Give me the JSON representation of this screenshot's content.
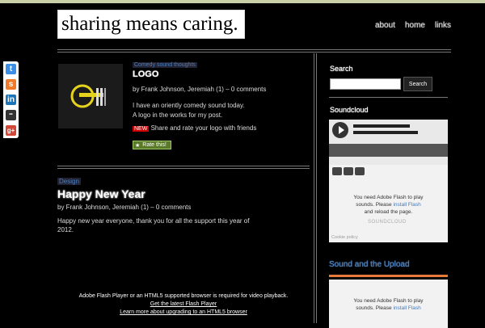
{
  "header": {
    "site_title": "sharing means caring.",
    "nav": [
      "about",
      "home",
      "links"
    ]
  },
  "share": {
    "items": [
      {
        "name": "twitter",
        "glyph": "t",
        "color": "#3a8ee6"
      },
      {
        "name": "soundcloud",
        "glyph": "s",
        "color": "#f07a2a"
      },
      {
        "name": "linkedin",
        "glyph": "in",
        "color": "#1b75b8"
      },
      {
        "name": "delicious",
        "glyph": "••",
        "color": "#333333"
      },
      {
        "name": "google-plus",
        "glyph": "g+",
        "color": "#d14836"
      }
    ]
  },
  "post1": {
    "category": "Comedy sound thoughts",
    "title": "LOGO",
    "meta": "by Frank Johnson, Jeremiah (1) – 0 comments",
    "body1": "I have an oriently comedy sound today.",
    "body2": "A logo in the works for my post.",
    "badge": "NEW",
    "body3": "Share and rate your logo with friends",
    "rate_label": "Rate this!"
  },
  "post2": {
    "tag": "Design",
    "title": "Happy New Year",
    "meta": "by Frank Johnson, Jeremiah (1) – 0 comments",
    "body1": "Happy new year everyone, thank you for all the support this year of",
    "body2": "2012."
  },
  "flash_notice": {
    "line1": "Adobe Flash Player or an HTML5 supported browser is required for video playback.",
    "link1": "Get the latest Flash Player",
    "link2": "Learn more about upgrading to an HTML5 browser"
  },
  "sidebar": {
    "search_heading": "Search",
    "search_button": "Search",
    "sound_heading": "Soundcloud",
    "flash_line1": "You need Adobe Flash to play",
    "flash_line2a": "sounds. Please",
    "flash_link": "install Flash",
    "flash_line3": "and reload the page.",
    "sc_logo": "SOUNDCLOUD",
    "cookie_text": "Cookie policy",
    "heading2": "Sound and the Upload",
    "flash2_line1": "You need Adobe Flash to play",
    "flash2_line2a": "sounds. Please",
    "flash2_link": "install Flash"
  }
}
